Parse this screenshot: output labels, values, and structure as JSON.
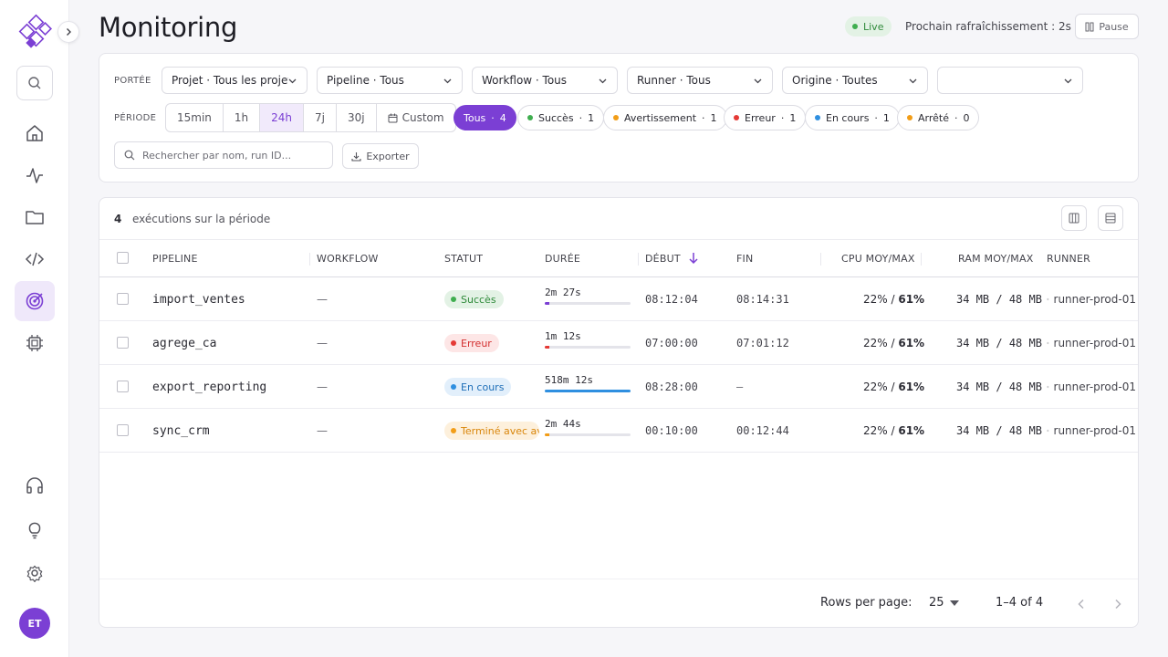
{
  "header": {
    "title": "Monitoring",
    "live_label": "Live",
    "refresh_text": "Prochain rafraîchissement : 2s",
    "pause_label": "Pause"
  },
  "sidebar": {
    "avatar_initials": "ET",
    "items": [
      {
        "icon": "home-icon"
      },
      {
        "icon": "activity-icon"
      },
      {
        "icon": "folder-icon"
      },
      {
        "icon": "code-icon"
      },
      {
        "icon": "target-icon",
        "active": true
      },
      {
        "icon": "chip-icon"
      },
      {
        "icon": "headphones-icon"
      },
      {
        "icon": "lightbulb-icon"
      },
      {
        "icon": "gear-icon"
      }
    ]
  },
  "filters": {
    "scope_label": "PORTÉE",
    "period_label": "PÉRIODE",
    "selects": [
      {
        "value": "Projet · Tous les projets"
      },
      {
        "value": "Pipeline · Tous"
      },
      {
        "value": "Workflow · Tous"
      },
      {
        "value": "Runner · Tous"
      },
      {
        "value": "Origine · Toutes"
      },
      {
        "value": ""
      }
    ],
    "periods": [
      {
        "label": "15min"
      },
      {
        "label": "1h"
      },
      {
        "label": "24h",
        "active": true
      },
      {
        "label": "7j"
      },
      {
        "label": "30j"
      },
      {
        "label": "Custom"
      }
    ],
    "status_chips": [
      {
        "label": "Tous",
        "count": "4",
        "active": true
      },
      {
        "label": "Succès",
        "count": "1",
        "color": "#3fae4f"
      },
      {
        "label": "Avertissement",
        "count": "1",
        "color": "#f29d17"
      },
      {
        "label": "Erreur",
        "count": "1",
        "color": "#e53935"
      },
      {
        "label": "En cours",
        "count": "1",
        "color": "#2f8fe0"
      },
      {
        "label": "Arrêté",
        "count": "0",
        "color": "#f29d17"
      }
    ],
    "search_placeholder": "Rechercher par nom, run ID...",
    "export_label": "Exporter"
  },
  "table": {
    "count": "4",
    "count_text": "exécutions sur la période",
    "columns": {
      "pipeline": "PIPELINE",
      "workflow": "WORKFLOW",
      "status": "STATUT",
      "duration": "DURÉE",
      "start": "DÉBUT",
      "end": "FIN",
      "cpu": "CPU MOY/MAX",
      "ram": "RAM MOY/MAX",
      "runner": "RUNNER"
    },
    "rows": [
      {
        "pipeline": "import_ventes",
        "workflow": "—",
        "status": "Succès",
        "status_color": "#3fae4f",
        "status_bg": "#e3f2e5",
        "status_text_color": "#2f8a3a",
        "duration": "2m 27s",
        "duration_fill": 0.05,
        "bar_color": "#7b3fd4",
        "start": "08:12:04",
        "end": "08:14:31",
        "cpu_avg": "22%",
        "cpu_max": "61%",
        "ram_avg": "34 MB",
        "ram_max": "48 MB",
        "runner": "runner-prod-01"
      },
      {
        "pipeline": "agrege_ca",
        "workflow": "—",
        "status": "Erreur",
        "status_color": "#e53935",
        "status_bg": "#fde6e6",
        "status_text_color": "#d32f2f",
        "duration": "1m 12s",
        "duration_fill": 0.05,
        "bar_color": "#e53935",
        "start": "07:00:00",
        "end": "07:01:12",
        "cpu_avg": "22%",
        "cpu_max": "61%",
        "ram_avg": "34 MB",
        "ram_max": "48 MB",
        "runner": "runner-prod-01"
      },
      {
        "pipeline": "export_reporting",
        "workflow": "—",
        "status": "En cours",
        "status_color": "#2f8fe0",
        "status_bg": "#e2effb",
        "status_text_color": "#1f6fb8",
        "duration": "518m 12s",
        "duration_fill": 1.0,
        "bar_color": "#2f8fe0",
        "start": "08:28:00",
        "end": "—",
        "cpu_avg": "22%",
        "cpu_max": "61%",
        "ram_avg": "34 MB",
        "ram_max": "48 MB",
        "runner": "runner-prod-01"
      },
      {
        "pipeline": "sync_crm",
        "workflow": "—",
        "status": "Terminé avec avertissement",
        "status_color": "#f29d17",
        "status_bg": "#fdf0dc",
        "status_text_color": "#d9860b",
        "duration": "2m 44s",
        "duration_fill": 0.05,
        "bar_color": "#f29d17",
        "start": "00:10:00",
        "end": "00:12:44",
        "cpu_avg": "22%",
        "cpu_max": "61%",
        "ram_avg": "34 MB",
        "ram_max": "48 MB",
        "runner": "runner-prod-01"
      }
    ]
  },
  "pagination": {
    "rows_per_page_label": "Rows per page:",
    "rows_per_page": "25",
    "range": "1–4 of 4"
  },
  "colors": {
    "accent": "#7b3fd4",
    "success": "#3fae4f",
    "warning": "#f29d17",
    "error": "#e53935",
    "running": "#2f8fe0"
  }
}
